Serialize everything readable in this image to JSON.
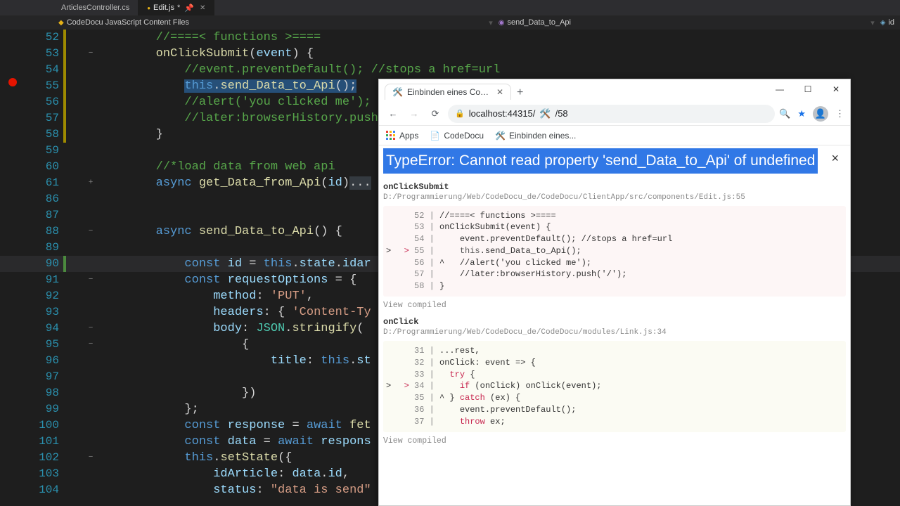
{
  "tabs": [
    {
      "label": "ArticlesController.cs",
      "active": false
    },
    {
      "label": "Edit.js",
      "active": true,
      "dirty": "*",
      "pin": "📌"
    }
  ],
  "breadcrumb": {
    "left": "CodeDocu JavaScript Content Files",
    "mid": "send_Data_to_Api",
    "right": "id"
  },
  "editor": {
    "lines": [
      {
        "n": 52,
        "mod": true,
        "txt": "        //====< functions >====",
        "cls": "comment"
      },
      {
        "n": 53,
        "mod": true,
        "fold": "−",
        "txt": "        onClickSubmit(event) {",
        "tokens": [
          [
            "",
            "        "
          ],
          [
            "fn",
            "onClickSubmit"
          ],
          [
            "punct",
            "("
          ],
          [
            "param",
            "event"
          ],
          [
            "punct",
            ") {"
          ]
        ]
      },
      {
        "n": 54,
        "mod": true,
        "txt": "            //event.preventDefault(); //stops a href=url",
        "cls": "comment"
      },
      {
        "n": 55,
        "mod": true,
        "bp": true,
        "txt": "            this.send_Data_to_Api();",
        "highlight": "sel",
        "tokens": [
          [
            "",
            "            "
          ],
          [
            "kw",
            "this"
          ],
          [
            "punct",
            "."
          ],
          [
            "fn",
            "send_Data_to_Api"
          ],
          [
            "punct",
            "();"
          ]
        ]
      },
      {
        "n": 56,
        "mod": true,
        "txt": "            //alert('you clicked me');",
        "cls": "comment"
      },
      {
        "n": 57,
        "mod": true,
        "txt": "            //later:browserHistory.push('/');",
        "cls": "comment"
      },
      {
        "n": 58,
        "mod": true,
        "txt": "        }",
        "cls": "punct"
      },
      {
        "n": 59,
        "txt": ""
      },
      {
        "n": 60,
        "txt": "        //*load data from web api",
        "cls": "comment"
      },
      {
        "n": 61,
        "fold": "+",
        "txt": "        async get_Data_from_Api(id)...",
        "tokens": [
          [
            "",
            "        "
          ],
          [
            "kw",
            "async "
          ],
          [
            "fn",
            "get_Data_from_Api"
          ],
          [
            "punct",
            "("
          ],
          [
            "param",
            "id"
          ],
          [
            "punct",
            ")"
          ],
          [
            "hl",
            "..."
          ]
        ]
      },
      {
        "n": 86,
        "txt": ""
      },
      {
        "n": 87,
        "txt": ""
      },
      {
        "n": 88,
        "fold": "−",
        "txt": "        async send_Data_to_Api() {",
        "tokens": [
          [
            "",
            "        "
          ],
          [
            "kw",
            "async "
          ],
          [
            "fn",
            "send_Data_to_Api"
          ],
          [
            "punct",
            "() {"
          ]
        ]
      },
      {
        "n": 89,
        "txt": ""
      },
      {
        "n": 90,
        "add": true,
        "txt": "            const id = this.state.idar",
        "tokens": [
          [
            "",
            "            "
          ],
          [
            "kw",
            "const "
          ],
          [
            "param",
            "id"
          ],
          [
            "punct",
            " = "
          ],
          [
            "kw",
            "this"
          ],
          [
            "punct",
            "."
          ],
          [
            "prop",
            "state"
          ],
          [
            "punct",
            "."
          ],
          [
            "prop",
            "idar"
          ]
        ],
        "boxed": true
      },
      {
        "n": 91,
        "fold": "−",
        "txt": "            const requestOptions = {",
        "tokens": [
          [
            "",
            "            "
          ],
          [
            "kw",
            "const "
          ],
          [
            "param",
            "requestOptions"
          ],
          [
            "punct",
            " = {"
          ]
        ]
      },
      {
        "n": 92,
        "txt": "                method: 'PUT',",
        "tokens": [
          [
            "",
            "                "
          ],
          [
            "prop",
            "method"
          ],
          [
            "punct",
            ": "
          ],
          [
            "str",
            "'PUT'"
          ],
          [
            "punct",
            ","
          ]
        ]
      },
      {
        "n": 93,
        "txt": "                headers: { 'Content-Ty",
        "tokens": [
          [
            "",
            "                "
          ],
          [
            "prop",
            "headers"
          ],
          [
            "punct",
            ": { "
          ],
          [
            "str",
            "'Content-Ty"
          ]
        ]
      },
      {
        "n": 94,
        "fold": "−",
        "txt": "                body: JSON.stringify(",
        "tokens": [
          [
            "",
            "                "
          ],
          [
            "prop",
            "body"
          ],
          [
            "punct",
            ": "
          ],
          [
            "type",
            "JSON"
          ],
          [
            "punct",
            "."
          ],
          [
            "fn",
            "stringify"
          ],
          [
            "punct",
            "("
          ]
        ]
      },
      {
        "n": 95,
        "fold": "−",
        "txt": "                    {",
        "cls": "punct"
      },
      {
        "n": 96,
        "txt": "                        title: this.st",
        "tokens": [
          [
            "",
            "                        "
          ],
          [
            "prop",
            "title"
          ],
          [
            "punct",
            ": "
          ],
          [
            "kw",
            "this"
          ],
          [
            "punct",
            "."
          ],
          [
            "prop",
            "st"
          ]
        ]
      },
      {
        "n": 97,
        "txt": ""
      },
      {
        "n": 98,
        "txt": "                    })",
        "cls": "punct"
      },
      {
        "n": 99,
        "txt": "            };",
        "cls": "punct"
      },
      {
        "n": 100,
        "txt": "            const response = await fet",
        "tokens": [
          [
            "",
            "            "
          ],
          [
            "kw",
            "const "
          ],
          [
            "param",
            "response"
          ],
          [
            "punct",
            " = "
          ],
          [
            "kw",
            "await "
          ],
          [
            "fn",
            "fet"
          ]
        ]
      },
      {
        "n": 101,
        "txt": "            const data = await respons",
        "tokens": [
          [
            "",
            "            "
          ],
          [
            "kw",
            "const "
          ],
          [
            "param",
            "data"
          ],
          [
            "punct",
            " = "
          ],
          [
            "kw",
            "await "
          ],
          [
            "param",
            "respons"
          ]
        ]
      },
      {
        "n": 102,
        "fold": "−",
        "txt": "            this.setState({",
        "tokens": [
          [
            "",
            "            "
          ],
          [
            "kw",
            "this"
          ],
          [
            "punct",
            "."
          ],
          [
            "fn",
            "setState"
          ],
          [
            "punct",
            "({"
          ]
        ]
      },
      {
        "n": 103,
        "txt": "                idArticle: data.id,",
        "tokens": [
          [
            "",
            "                "
          ],
          [
            "prop",
            "idArticle"
          ],
          [
            "punct",
            ": "
          ],
          [
            "param",
            "data"
          ],
          [
            "punct",
            "."
          ],
          [
            "prop",
            "id"
          ],
          [
            "punct",
            ","
          ]
        ]
      },
      {
        "n": 104,
        "txt": "                status: \"data is send\"",
        "tokens": [
          [
            "",
            "                "
          ],
          [
            "prop",
            "status"
          ],
          [
            "punct",
            ": "
          ],
          [
            "str",
            "\"data is send\""
          ]
        ]
      }
    ]
  },
  "browser": {
    "tab_title": "Einbinden eines Configurato",
    "url_host": "localhost:44315/",
    "url_path": "/58",
    "bookmarks": [
      {
        "label": "Apps",
        "icon": "apps"
      },
      {
        "label": "CodeDocu",
        "icon": "doc"
      },
      {
        "label": "Einbinden eines...",
        "icon": "fav"
      }
    ],
    "error": {
      "title": "TypeError: Cannot read property 'send_Data_to_Api' of undefined",
      "frames": [
        {
          "name": "onClickSubmit",
          "path": "D:/Programmierung/Web/CodeDocu_de/CodeDocu/ClientApp/src/components/Edit.js:55",
          "view_compiled": "View compiled",
          "bg": "normal",
          "code": [
            {
              "n": 52,
              "t": "//====< functions >===="
            },
            {
              "n": 53,
              "t": "onClickSubmit(event) {"
            },
            {
              "n": 54,
              "t": "    event.preventDefault(); //stops a href=url"
            },
            {
              "n": 55,
              "t": "    this.send_Data_to_Api();",
              "cur": true
            },
            {
              "n": 56,
              "t": "^   //alert('you clicked me');",
              "caret": true
            },
            {
              "n": 57,
              "t": "    //later:browserHistory.push('/');"
            },
            {
              "n": 58,
              "t": "}"
            }
          ]
        },
        {
          "name": "onClick",
          "path": "D:/Programmierung/Web/CodeDocu_de/CodeDocu/modules/Link.js:34",
          "view_compiled": "View compiled",
          "bg": "alt",
          "code": [
            {
              "n": 31,
              "t": "...rest,"
            },
            {
              "n": 32,
              "t": "onClick: event => {"
            },
            {
              "n": 33,
              "t": "  try {"
            },
            {
              "n": 34,
              "t": "    if (onClick) onClick(event);",
              "cur": true
            },
            {
              "n": 35,
              "t": "^ } catch (ex) {",
              "caret": true
            },
            {
              "n": 36,
              "t": "    event.preventDefault();"
            },
            {
              "n": 37,
              "t": "    throw ex;"
            }
          ]
        }
      ]
    }
  }
}
